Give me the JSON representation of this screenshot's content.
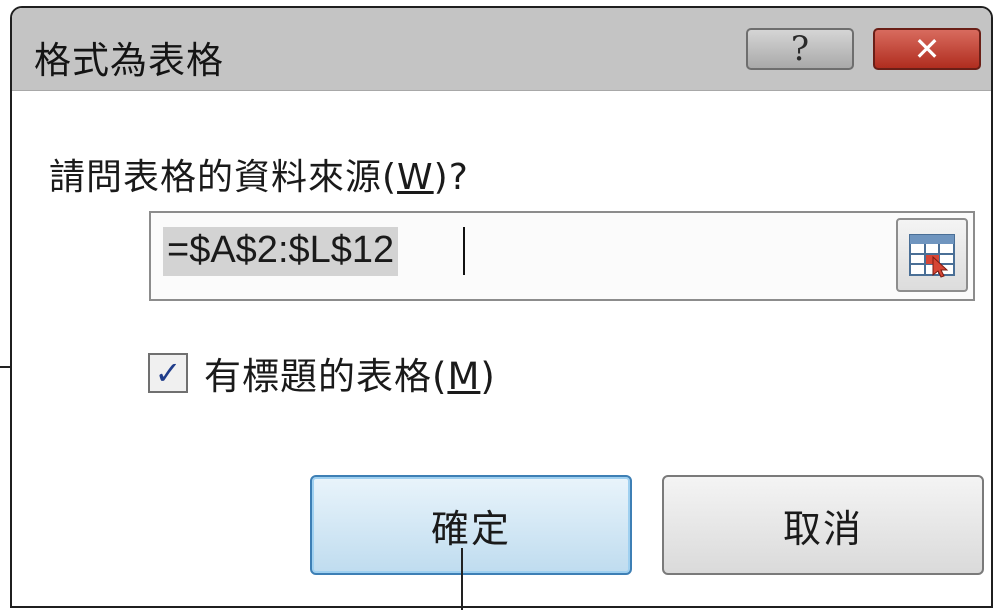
{
  "dialog": {
    "title": "格式為表格",
    "help_glyph": "?",
    "close_glyph": "✕",
    "prompt_prefix": "請問表格的資料來源(",
    "prompt_access_key": "W",
    "prompt_suffix": ")?",
    "range_value": "=$A$2:$L$12",
    "collapse_icon": "range-selector-icon",
    "checkbox": {
      "checked": true,
      "mark": "✓",
      "label_prefix": "有標題的表格(",
      "label_access_key": "M",
      "label_suffix": ")"
    },
    "ok_label": "確定",
    "cancel_label": "取消"
  },
  "colors": {
    "titlebar": "#c4c4c4",
    "close_button": "#c0392b",
    "ok_button_border": "#3d7fb5",
    "check_mark": "#1f3c8a"
  }
}
